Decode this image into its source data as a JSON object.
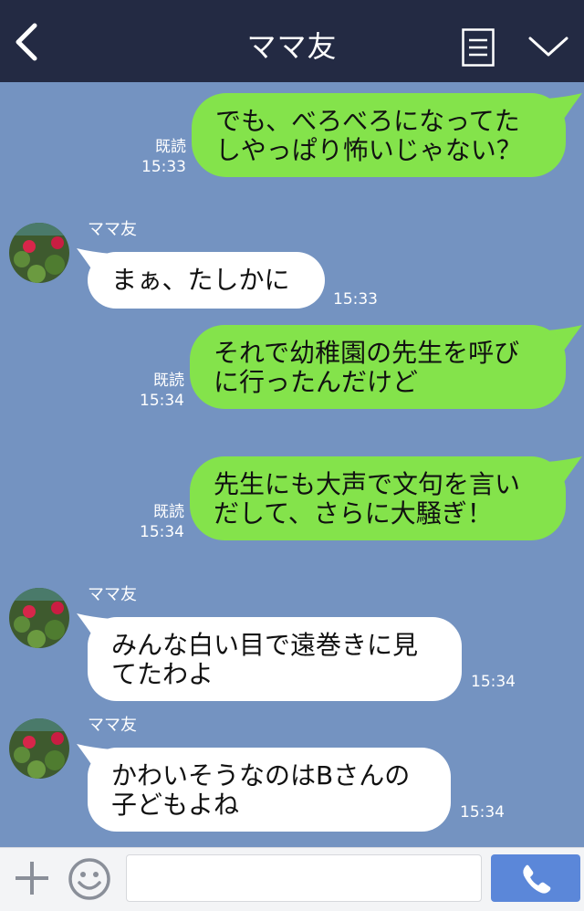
{
  "header": {
    "title": "ママ友"
  },
  "messages": [
    {
      "dir": "out",
      "text": "でも、べろべろになってた\nしやっぱり怖いじゃない？",
      "read": "既読",
      "time": "15:33"
    },
    {
      "dir": "in",
      "sender": "ママ友",
      "text": "まぁ、たしかに",
      "time": "15:33"
    },
    {
      "dir": "out",
      "text": "それで幼稚園の先生を呼び\nに行ったんだけど",
      "read": "既読",
      "time": "15:34"
    },
    {
      "dir": "out",
      "text": "先生にも大声で文句を言い\nだして、さらに大騒ぎ！",
      "read": "既読",
      "time": "15:34"
    },
    {
      "dir": "in",
      "sender": "ママ友",
      "text": "みんな白い目で遠巻きに見\nてたわよ",
      "time": "15:34"
    },
    {
      "dir": "in",
      "sender": "ママ友",
      "text": "かわいそうなのはBさんの\n子どもよね",
      "time": "15:34"
    }
  ],
  "input": {
    "value": "",
    "placeholder": ""
  },
  "colors": {
    "header_bg": "#232a43",
    "chat_bg": "#7493c1",
    "outgoing_bubble": "#84e34b",
    "incoming_bubble": "#ffffff",
    "call_button": "#5b87d9"
  },
  "icons": {
    "back": "chevron-left-icon",
    "menu": "document-menu-icon",
    "collapse": "chevron-down-icon",
    "plus": "plus-icon",
    "emoji": "smiley-icon",
    "call": "phone-icon"
  }
}
